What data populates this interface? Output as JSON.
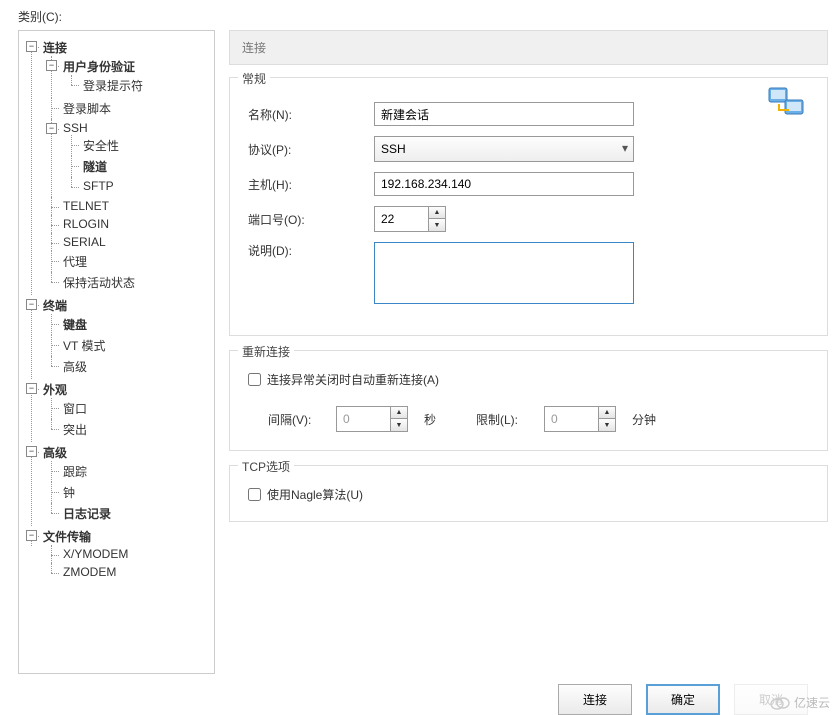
{
  "labels": {
    "category": "类别(C):",
    "panel_title": "连接",
    "general_group": "常规",
    "name": "名称(N):",
    "protocol": "协议(P):",
    "host": "主机(H):",
    "port": "端口号(O):",
    "desc": "说明(D):",
    "reconnect_group": "重新连接",
    "auto_reconnect": "连接异常关闭时自动重新连接(A)",
    "interval": "间隔(V):",
    "seconds": "秒",
    "limit": "限制(L):",
    "minutes": "分钟",
    "tcp_group": "TCP选项",
    "nagle": "使用Nagle算法(U)",
    "btn_connect": "连接",
    "btn_ok": "确定",
    "btn_cancel": "取消"
  },
  "values": {
    "name": "新建会话",
    "protocol": "SSH",
    "host": "192.168.234.140",
    "port": "22",
    "desc": "",
    "interval": "0",
    "limit": "0"
  },
  "tree": {
    "connection": "连接",
    "auth": "用户身份验证",
    "login_prompt": "登录提示符",
    "login_script": "登录脚本",
    "ssh": "SSH",
    "security": "安全性",
    "tunnel": "隧道",
    "sftp": "SFTP",
    "telnet": "TELNET",
    "rlogin": "RLOGIN",
    "serial": "SERIAL",
    "proxy": "代理",
    "keepalive": "保持活动状态",
    "terminal": "终端",
    "keyboard": "键盘",
    "vtmode": "VT 模式",
    "advanced": "高级",
    "appearance": "外观",
    "window": "窗口",
    "highlight": "突出",
    "adv": "高级",
    "trace": "跟踪",
    "bell": "钟",
    "logging": "日志记录",
    "filetransfer": "文件传输",
    "xymodem": "X/YMODEM",
    "zmodem": "ZMODEM"
  },
  "watermark": "亿速云"
}
